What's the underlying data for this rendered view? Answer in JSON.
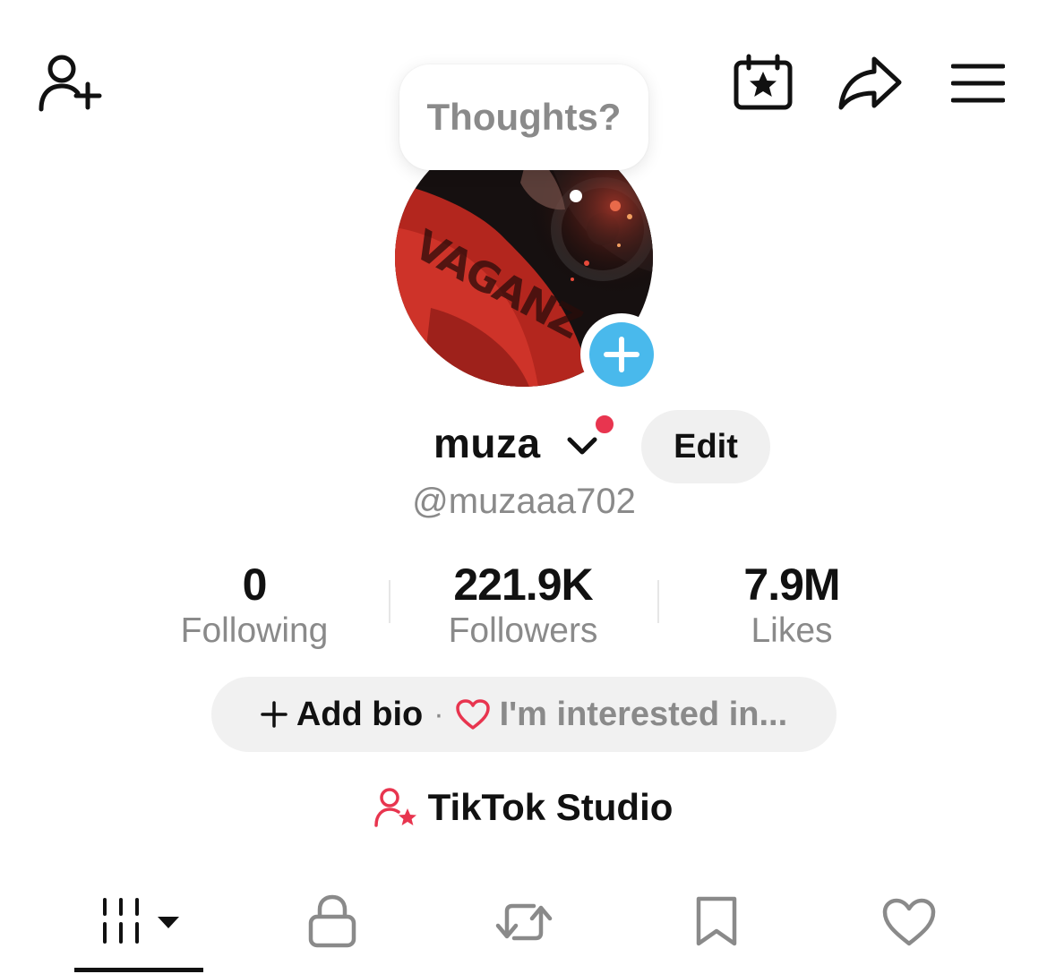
{
  "header": {
    "icons": [
      "add-friend-icon",
      "calendar-star-icon",
      "share-icon",
      "menu-icon"
    ]
  },
  "bubble": {
    "text": "Thoughts?"
  },
  "profile": {
    "display_name": "muza",
    "edit_label": "Edit",
    "handle": "@muzaaa702"
  },
  "stats": [
    {
      "value": "0",
      "label": "Following"
    },
    {
      "value": "221.9K",
      "label": "Followers"
    },
    {
      "value": "7.9M",
      "label": "Likes"
    }
  ],
  "bio": {
    "add_label": "Add bio",
    "separator": "·",
    "interest_label": "I'm interested in..."
  },
  "studio": {
    "label": "TikTok Studio"
  },
  "tabs": {
    "icons": [
      "grid-icon",
      "lock-icon",
      "repost-icon",
      "bookmark-icon",
      "heart-icon"
    ],
    "active": "grid-icon"
  },
  "colors": {
    "accent_red": "#e8354f",
    "avatar_add_blue": "#49b9ec",
    "muted_text": "#8a8a8a",
    "pill_bg": "#f1f1f1"
  }
}
